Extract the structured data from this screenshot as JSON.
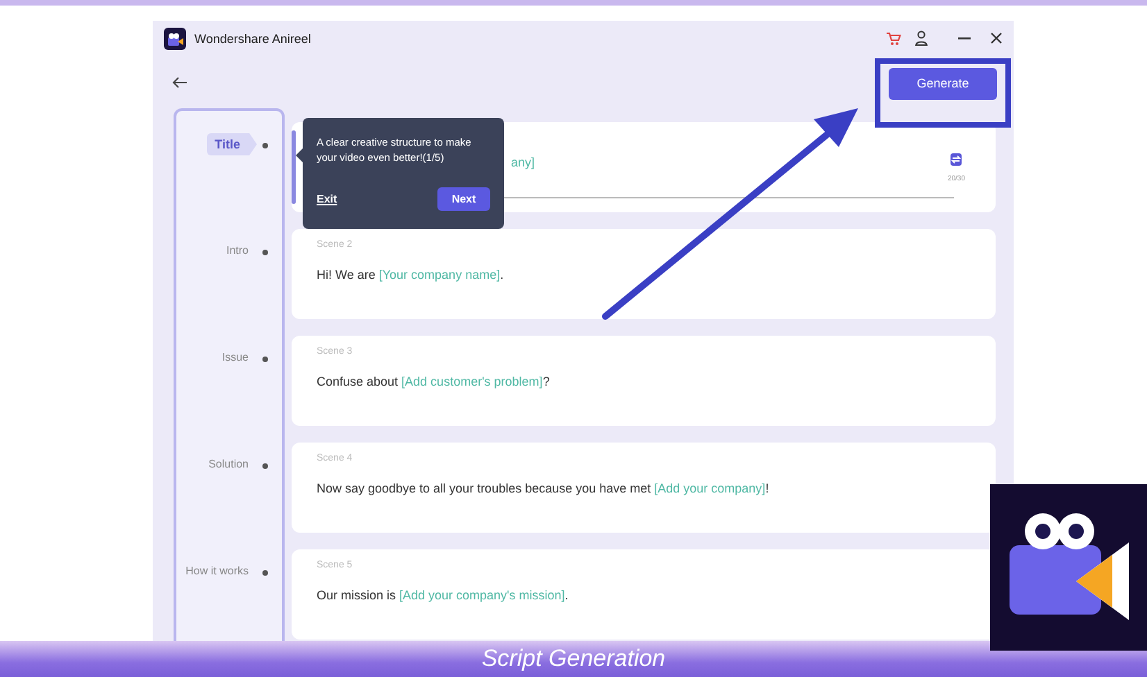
{
  "window": {
    "title": "Wondershare Anireel"
  },
  "header": {
    "generate_button": "Generate"
  },
  "steps": [
    {
      "label": "Title",
      "selected": true
    },
    {
      "label": "Intro",
      "selected": false
    },
    {
      "label": "Issue",
      "selected": false
    },
    {
      "label": "Solution",
      "selected": false
    },
    {
      "label": "How it works",
      "selected": false
    }
  ],
  "scenes": [
    {
      "kind": "editing",
      "counter": "20/30",
      "segments": [
        {
          "kind": "placeholder",
          "text": "any]"
        }
      ]
    },
    {
      "kind": "plain",
      "label": "Scene 2",
      "segments": [
        {
          "kind": "plain",
          "text": "Hi! We are "
        },
        {
          "kind": "placeholder",
          "text": "[Your company name]"
        },
        {
          "kind": "plain",
          "text": "."
        }
      ]
    },
    {
      "kind": "plain",
      "label": "Scene 3",
      "segments": [
        {
          "kind": "plain",
          "text": "Confuse about "
        },
        {
          "kind": "placeholder",
          "text": "[Add customer's problem]"
        },
        {
          "kind": "plain",
          "text": "?"
        }
      ]
    },
    {
      "kind": "plain",
      "label": "Scene 4",
      "segments": [
        {
          "kind": "plain",
          "text": "Now say goodbye to all your troubles because you have met "
        },
        {
          "kind": "placeholder",
          "text": "[Add your company]"
        },
        {
          "kind": "plain",
          "text": "!"
        }
      ]
    },
    {
      "kind": "plain",
      "label": "Scene 5",
      "segments": [
        {
          "kind": "plain",
          "text": "Our mission is "
        },
        {
          "kind": "placeholder",
          "text": "[Add your company's mission]"
        },
        {
          "kind": "plain",
          "text": "."
        }
      ]
    }
  ],
  "tooltip": {
    "text": "A clear creative structure to make your video even better!(1/5)",
    "exit": "Exit",
    "next": "Next"
  },
  "caption": "Script Generation"
}
